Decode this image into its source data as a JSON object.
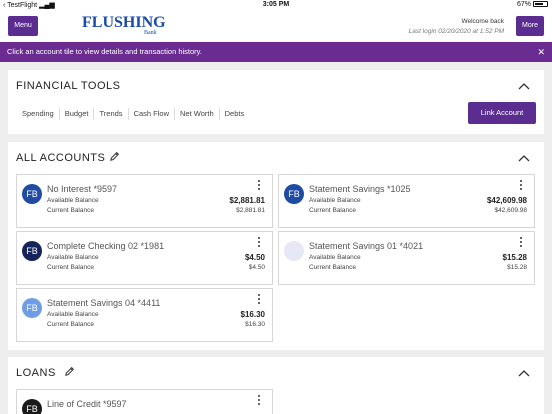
{
  "status_bar": {
    "carrier": "TestFlight",
    "time": "3:05 PM",
    "battery": "67%"
  },
  "header": {
    "menu_label": "Menu",
    "more_label": "More",
    "logo_word": "FLUSHING",
    "logo_sub": "Bank",
    "welcome": "Welcome back",
    "last_login": "Last login 02/20/2020 at 1:52 PM"
  },
  "banner": {
    "text": "Click an account tile to view details and transaction history.",
    "close": "✕"
  },
  "financial_tools": {
    "title": "FINANCIAL TOOLS",
    "links": [
      "Spending",
      "Budget",
      "Trends",
      "Cash Flow",
      "Net Worth",
      "Debts"
    ],
    "link_account": "Link Account"
  },
  "all_accounts": {
    "title": "ALL ACCOUNTS",
    "tiles": [
      {
        "initials": "FB",
        "name": "No Interest *9597",
        "available_label": "Available Balance",
        "current_label": "Current Balance",
        "available": "$2,881.81",
        "current": "$2,881.81",
        "color": "#1f4ba5"
      },
      {
        "initials": "FB",
        "name": "Statement Savings *1025",
        "available_label": "Available Balance",
        "current_label": "Current Balance",
        "available": "$42,609.98",
        "current": "$42,609.98",
        "color": "#1f4ba5"
      },
      {
        "initials": "FB",
        "name": "Complete Checking 02 *1981",
        "available_label": "Available Balance",
        "current_label": "Current Balance",
        "available": "$4.50",
        "current": "$4.50",
        "color": "#16245c"
      },
      {
        "initials": "",
        "name": "Statement Savings 01 *4021",
        "available_label": "Available Balance",
        "current_label": "Current Balance",
        "available": "$15.28",
        "current": "$15.28",
        "color": "#e6e8f5"
      },
      {
        "initials": "FB",
        "name": "Statement Savings 04 *4411",
        "available_label": "Available Balance",
        "current_label": "Current Balance",
        "available": "$16.30",
        "current": "$16.30",
        "color": "#6e9de6"
      }
    ]
  },
  "loans": {
    "title": "LOANS",
    "tiles": [
      {
        "initials": "FB",
        "name": "Line of Credit *9597",
        "color": "#1a1a1a"
      }
    ]
  }
}
